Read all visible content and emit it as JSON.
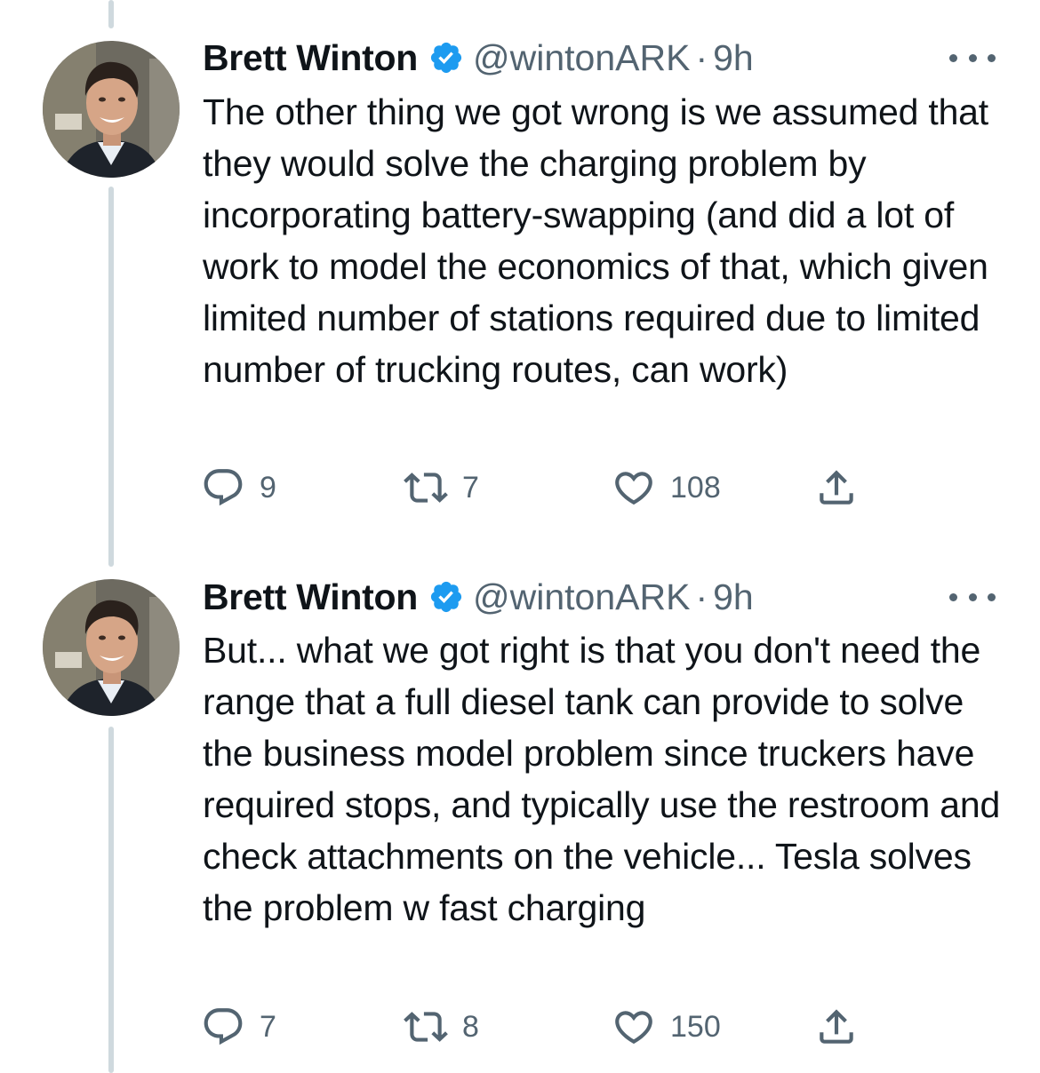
{
  "tweets": [
    {
      "author_name": "Brett Winton",
      "handle": "@wintonARK",
      "separator": "·",
      "time": "9h",
      "text": "The other thing we got wrong is we assumed that they would solve the charging problem by incorporating battery-swapping (and did a lot of work to model the economics of that, which given limited number of stations required due to limited number of trucking routes, can work)",
      "replies": "9",
      "retweets": "7",
      "likes": "108"
    },
    {
      "author_name": "Brett Winton",
      "handle": "@wintonARK",
      "separator": "·",
      "time": "9h",
      "text": "But... what we got right is that you don't need the range that a full diesel tank can provide to solve the business model problem since truckers have required stops, and typically use the restroom and check attachments on the vehicle... Tesla solves the problem w fast charging",
      "replies": "7",
      "retweets": "8",
      "likes": "150"
    }
  ],
  "colors": {
    "verified_badge": "#1d9bf0",
    "secondary_text": "#536471",
    "thread_line": "#cfd9de"
  },
  "icons": {
    "reply": "reply-icon",
    "retweet": "retweet-icon",
    "like": "heart-icon",
    "share": "share-icon",
    "more": "more-icon",
    "verified": "verified-badge-icon"
  }
}
